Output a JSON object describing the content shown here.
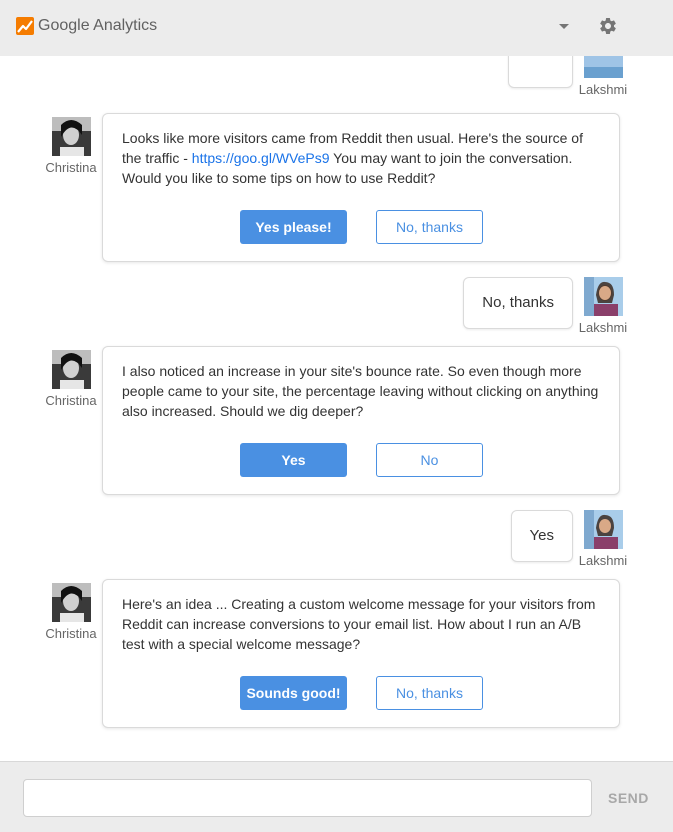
{
  "app": {
    "title": "Google Analytics",
    "accent_color": "#f57c00",
    "primary_button_color": "#4a90e2",
    "link_color": "#1a73e8"
  },
  "header": {
    "logo_icon": "analytics-logo-icon",
    "dropdown_icon": "caret-down-icon",
    "settings_icon": "gear-icon"
  },
  "bot": {
    "name": "Christina"
  },
  "user": {
    "name": "Lakshmi"
  },
  "messages": {
    "msg1": {
      "text_before_link": "Looks like more visitors came from Reddit then usual. Here's the source of the traffic - ",
      "link": "https://goo.gl/WVePs9",
      "text_after_link": " You may want to join the conversation. Would you like to some tips on how to use Reddit?",
      "primary_label": "Yes please!",
      "secondary_label": "No, thanks"
    },
    "reply1": "No, thanks",
    "msg2": {
      "text": "I also noticed an increase in your site's bounce rate. So even though more people came to your site, the percentage leaving without clicking on anything also increased. Should we dig deeper?",
      "primary_label": "Yes",
      "secondary_label": "No"
    },
    "reply2": "Yes",
    "msg3": {
      "text": "Here's an idea ... Creating a custom welcome message for your visitors from Reddit can increase conversions to your email list. How about I run an A/B test with a special welcome message?",
      "primary_label": "Sounds good!",
      "secondary_label": "No, thanks"
    }
  },
  "footer": {
    "input_value": "",
    "input_placeholder": "",
    "send_label": "SEND"
  }
}
